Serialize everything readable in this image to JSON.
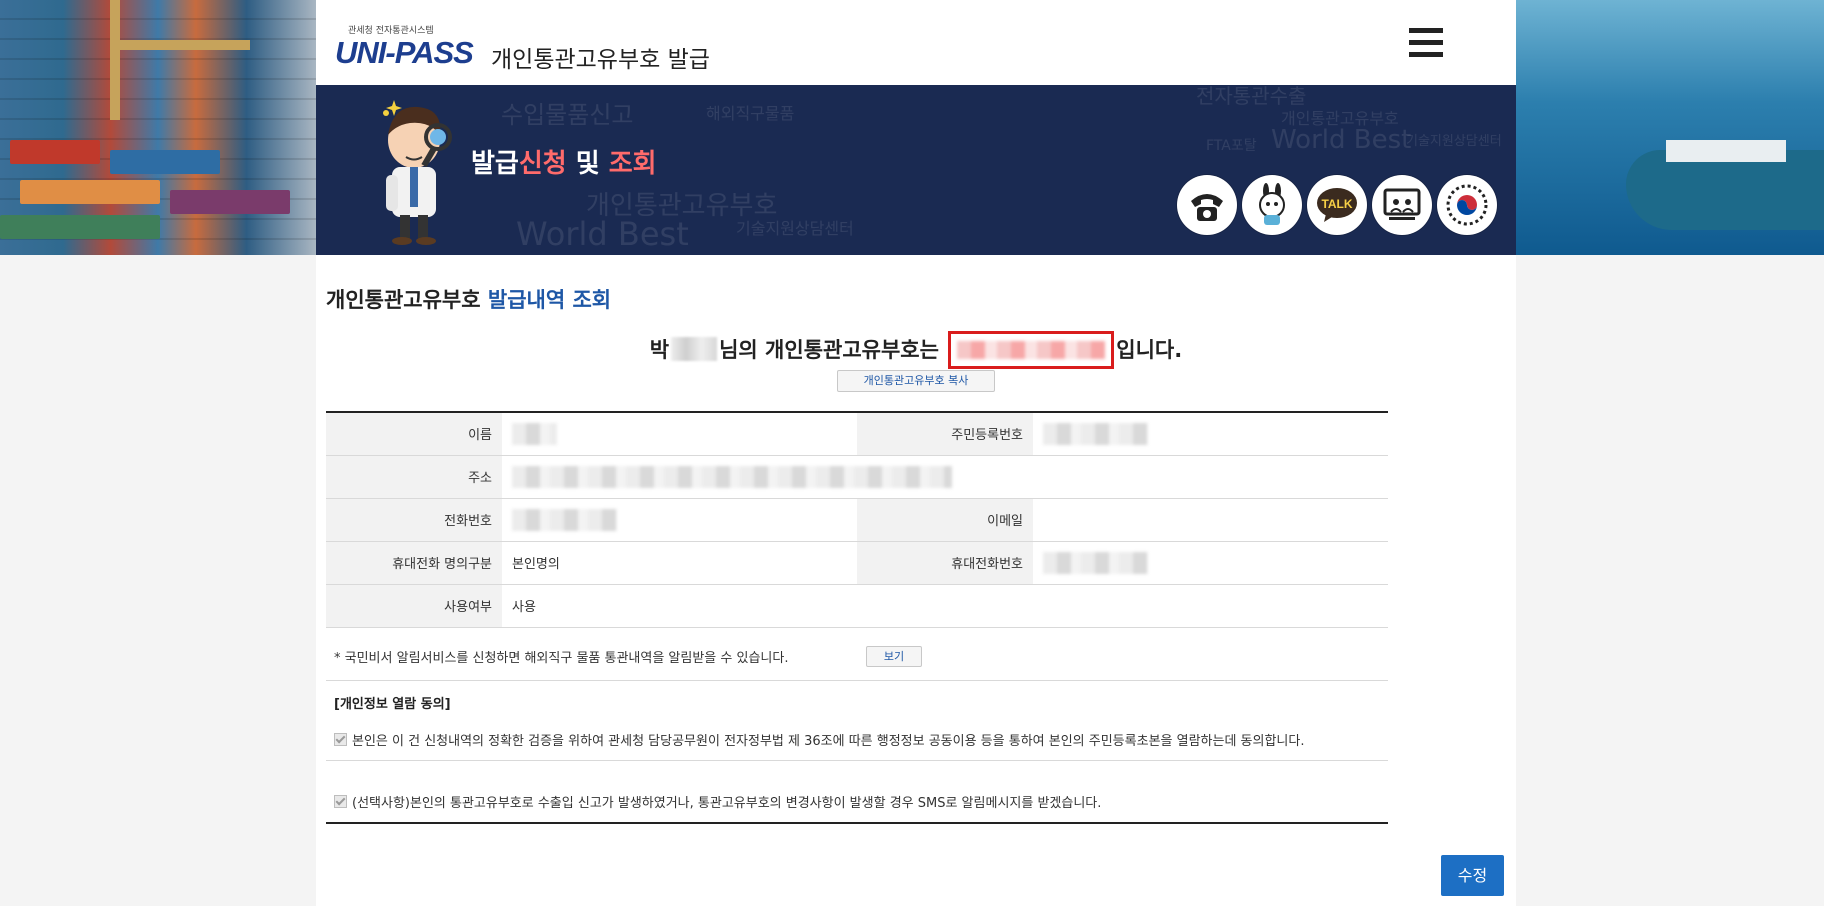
{
  "header": {
    "logo_sub": "관세청 전자통관시스템",
    "logo_main": "UNI-PASS",
    "title": "개인통관고유부호 발급",
    "menu_icon": "hamburger-icon"
  },
  "banner": {
    "title_part1": "발급",
    "title_part2": "신청",
    "title_part3": " 및 ",
    "title_part4": "조회",
    "background_words": [
      "수입물품신고",
      "해외직구물품",
      "개인통관고유부호",
      "World Best",
      "기술지원상담센터",
      "전자통관수출",
      "FTA포탈",
      "World Best",
      "개인통관고유부호",
      "기술지원상담센터"
    ],
    "icons": [
      "phone-icon",
      "mascot-icon",
      "talk-icon",
      "remote-support-icon",
      "korea-emblem-icon"
    ],
    "talk_label": "TALK"
  },
  "page": {
    "heading_part1": "개인통관고유부호 ",
    "heading_part2": "발급내역 조회",
    "result_prefix": "박",
    "result_middle": "님의 개인통관고유부호는",
    "result_suffix": "입니다.",
    "copy_button": "개인통관고유부호 복사"
  },
  "info_table": {
    "name_label": "이름",
    "rrn_label": "주민등록번호",
    "address_label": "주소",
    "phone_label": "전화번호",
    "email_label": "이메일",
    "mobile_type_label": "휴대전화 명의구분",
    "mobile_type_value": "본인명의",
    "mobile_label": "휴대전화번호",
    "usage_label": "사용여부",
    "usage_value": "사용"
  },
  "notice": {
    "text": "* 국민비서 알림서비스를 신청하면 해외직구 물품 통관내역을 알림받을 수 있습니다.",
    "view_button": "보기"
  },
  "consent": {
    "title": "[개인정보 열람 동의]",
    "item1": "본인은 이 건 신청내역의 정확한 검증을 위하여 관세청 담당공무원이 전자정부법 제 36조에 따른 행정정보 공동이용 등을 통하여 본인의 주민등록초본을 열람하는데 동의합니다.",
    "item2": "(선택사항)본인의 통관고유부호로 수출입 신고가 발생하였거나, 통관고유부호의 변경사항이 발생할 경우 SMS로 알림메시지를 받겠습니다."
  },
  "actions": {
    "edit_button": "수정"
  },
  "colors": {
    "accent_blue": "#1d6fc4",
    "heading_blue": "#1e57a6",
    "highlight_red": "#d91c1c",
    "banner_navy": "#1a2a52"
  }
}
